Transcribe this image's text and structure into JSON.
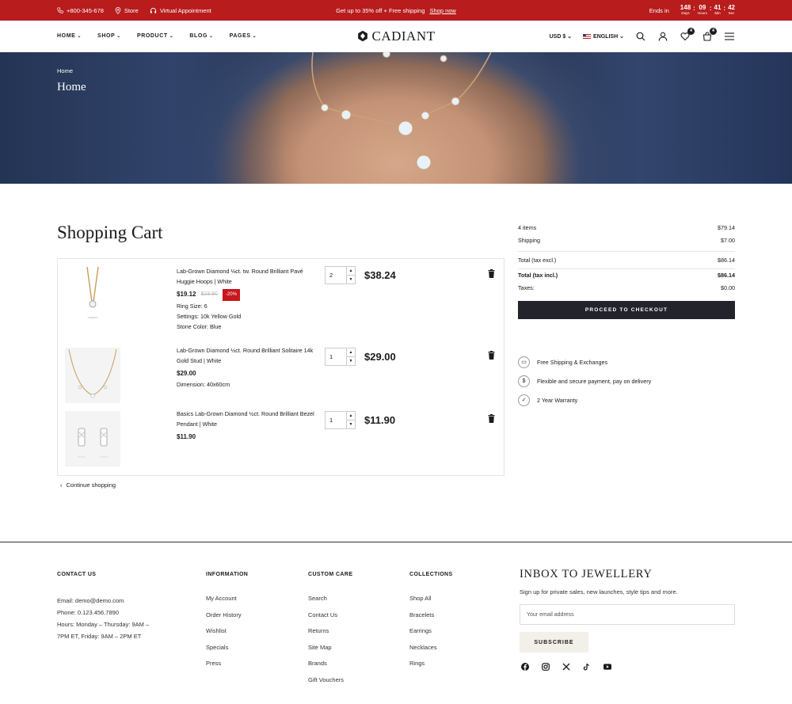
{
  "topbar": {
    "phone": "+800-345-678",
    "store": "Store",
    "appointment": "Virtual Appointment",
    "promo": "Get up to 35% off + Free shipping",
    "promo_link": "Shop now",
    "ends_in": "Ends in",
    "countdown": [
      {
        "num": "148",
        "label": "Days"
      },
      {
        "num": "09",
        "label": "Hours"
      },
      {
        "num": "41",
        "label": "Min"
      },
      {
        "num": "42",
        "label": "Sec"
      }
    ]
  },
  "header": {
    "nav": [
      "HOME",
      "SHOP",
      "PRODUCT",
      "BLOG",
      "PAGES"
    ],
    "logo": "CADIANT",
    "currency": "USD $",
    "language": "ENGLISH",
    "wishlist_count": "4",
    "cart_count": "4"
  },
  "hero": {
    "breadcrumb": "Home",
    "title": "Home"
  },
  "cart": {
    "title": "Shopping Cart",
    "items": [
      {
        "name": "Lab-Grown Diamond ⅛ct. tw. Round Brilliant Pavé Huggie Hoops | White",
        "price": "$19.12",
        "old_price": "$23.90",
        "discount": "-20%",
        "opt1": "Ring Size: 6",
        "opt2": "Settings: 10k Yellow Gold",
        "opt3": "Stone Color: Blue",
        "qty": "2",
        "total": "$38.24"
      },
      {
        "name": "Lab-Grown Diamond ½ct. Round Brilliant Solitaire 14k Gold Stud | White",
        "price": "$29.00",
        "opt1": "Dimension: 40x60cm",
        "qty": "1",
        "total": "$29.00"
      },
      {
        "name": "Basics Lab-Grown Diamond ½ct. Round Brilliant Bezel Pendant | White",
        "price": "$11.90",
        "qty": "1",
        "total": "$11.90"
      }
    ],
    "continue": "Continue shopping"
  },
  "summary": {
    "items_label": "4 items",
    "items_value": "$79.14",
    "shipping_label": "Shipping",
    "shipping_value": "$7.00",
    "excl_label": "Total (tax excl.)",
    "excl_value": "$86.14",
    "incl_label": "Total (tax incl.)",
    "incl_value": "$86.14",
    "taxes_label": "Taxes:",
    "taxes_value": "$0.00",
    "checkout": "PROCEED TO CHECKOUT",
    "perks": [
      "Free Shipping & Exchanges",
      "Flexible and secure payment, pay on delivery",
      "2 Year Warranty"
    ]
  },
  "footer": {
    "contact_title": "CONTACT US",
    "contact": [
      "Email: demo@demo.com",
      "Phone: 0.123.456.7890",
      "Hours: Monday – Thursday: 9AM –",
      "7PM ET, Friday: 9AM – 2PM ET"
    ],
    "info_title": "INFORMATION",
    "info": [
      "My Account",
      "Order History",
      "Wishlist",
      "Specials",
      "Press"
    ],
    "care_title": "CUSTOM CARE",
    "care": [
      "Search",
      "Contact Us",
      "Returns",
      "Site Map",
      "Brands",
      "Gift Vouchers"
    ],
    "coll_title": "COLLECTIONS",
    "collections": [
      "Shop All",
      "Bracelets",
      "Earrings",
      "Necklaces",
      "Rings"
    ],
    "news_title": "INBOX TO JEWELLERY",
    "news_text": "Sign up for private sales, new launches, style tips and more.",
    "email_placeholder": "Your email address",
    "subscribe": "SUBSCRIBE",
    "social": [
      "facebook-icon",
      "instagram-icon",
      "x-icon",
      "tiktok-icon",
      "youtube-icon"
    ]
  }
}
